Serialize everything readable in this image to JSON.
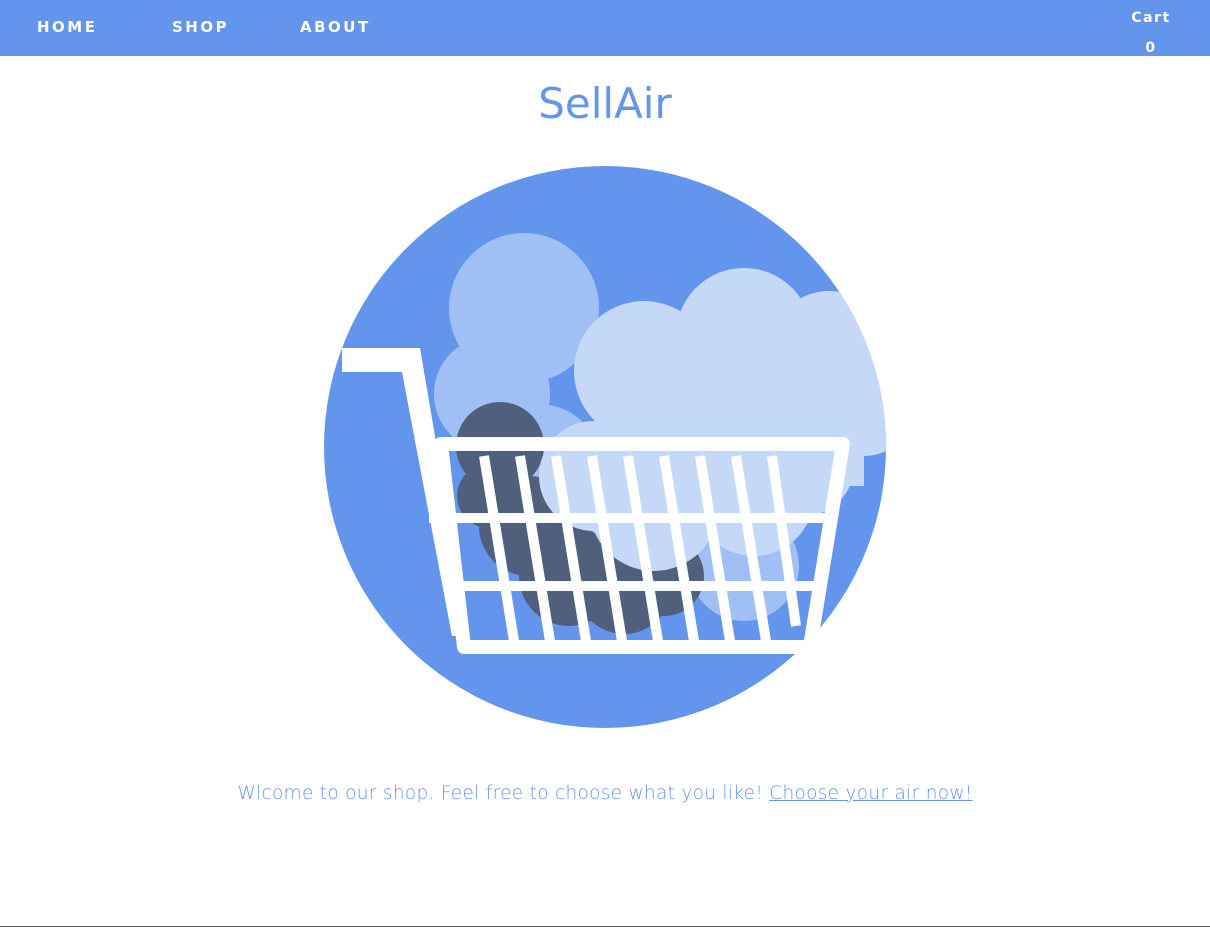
{
  "nav": {
    "items": [
      {
        "label": "HOME"
      },
      {
        "label": "SHOP"
      },
      {
        "label": "ABOUT"
      }
    ],
    "cart_label": "Cart",
    "cart_count": "0"
  },
  "header": {
    "title": "SellAir"
  },
  "hero": {
    "icon": "shopping-cart-with-clouds-illustration"
  },
  "main": {
    "welcome_text": "Wlcome to our shop. Feel free to choose what you like!",
    "cta_link": "Choose your air now!"
  },
  "colors": {
    "brand": "#6495ed",
    "cloud_light": "#c5d8f8",
    "cloud_mid": "#a0bff4",
    "cloud_dark": "#505f7c",
    "background": "#ffffff"
  }
}
